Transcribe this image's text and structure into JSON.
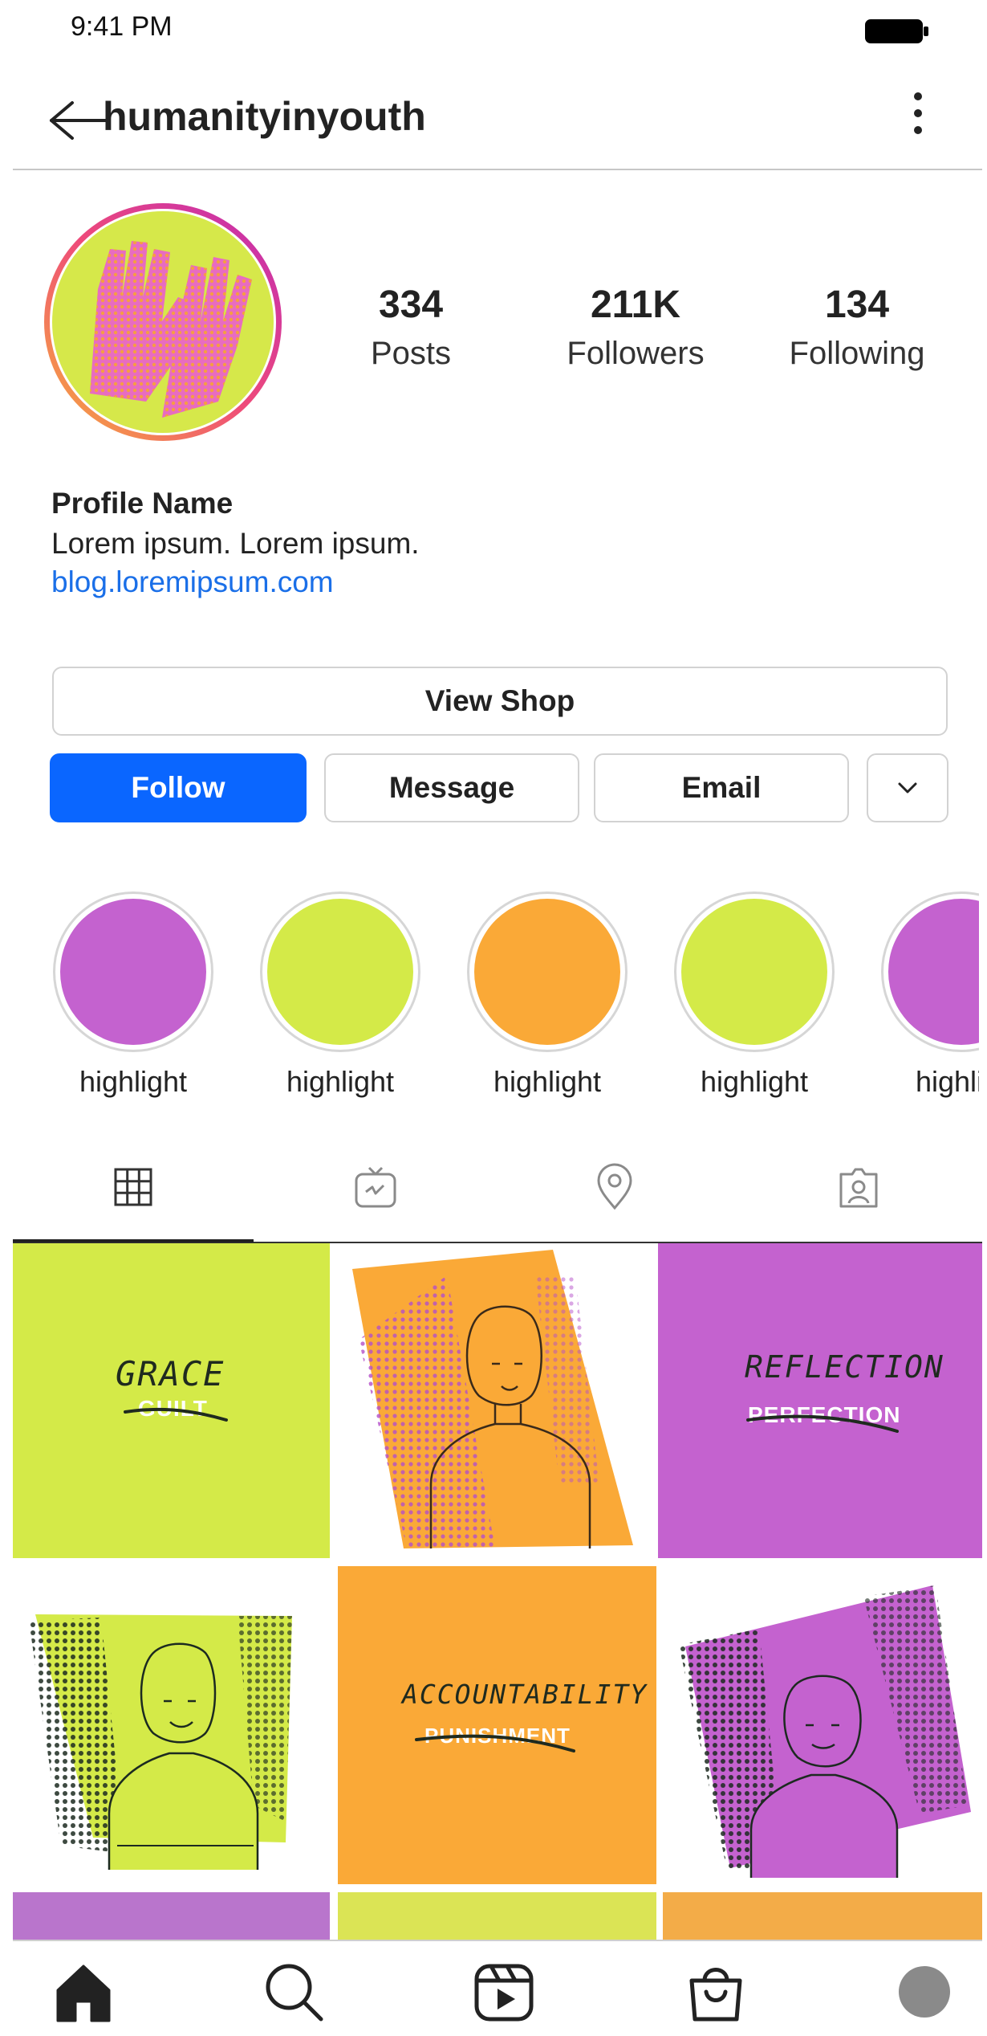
{
  "status_bar": {
    "time": "9:41 PM",
    "battery_icon": "battery-full-icon"
  },
  "header": {
    "username": "humanityinyouth",
    "back_icon": "arrow-left-icon",
    "more_icon": "more-vertical-icon"
  },
  "stats": [
    {
      "value": "334",
      "label": "Posts"
    },
    {
      "value": "211K",
      "label": "Followers"
    },
    {
      "value": "134",
      "label": "Following"
    }
  ],
  "bio": {
    "name": "Profile Name",
    "text": "Lorem ipsum. Lorem ipsum.",
    "link": "blog.loremipsum.com"
  },
  "buttons": {
    "view_shop": "View Shop",
    "follow": "Follow",
    "message": "Message",
    "email": "Email"
  },
  "highlights": [
    {
      "label": "highlight",
      "color": "#c462cf"
    },
    {
      "label": "highlight",
      "color": "#d4ea48"
    },
    {
      "label": "highlight",
      "color": "#faa937"
    },
    {
      "label": "highlight",
      "color": "#d4ea48"
    },
    {
      "label": "highlight",
      "color": "#c462cf"
    }
  ],
  "tabs": [
    {
      "icon": "grid-icon",
      "active": true
    },
    {
      "icon": "igtv-icon",
      "active": false
    },
    {
      "icon": "location-pin-icon",
      "active": false
    },
    {
      "icon": "tagged-user-icon",
      "active": false
    }
  ],
  "posts": [
    {
      "word": "GRACE",
      "struck": "GUILT",
      "bg": "#d4ea48"
    },
    {
      "bg": "#faa937"
    },
    {
      "word": "REFLECTION",
      "struck": "PERFECTION",
      "bg": "#c462cf"
    },
    {
      "bg": "#d4ea48"
    },
    {
      "word": "ACCOUNTABILITY",
      "struck": "PUNISHMENT",
      "bg": "#faa937"
    },
    {
      "bg": "#c462cf"
    }
  ],
  "colors": {
    "lime": "#d4ea48",
    "orange": "#faa937",
    "purple": "#c462cf",
    "follow_blue": "#0a66ff",
    "link_blue": "#1a6fe8"
  },
  "bottom_nav": [
    {
      "icon": "home-icon"
    },
    {
      "icon": "search-icon"
    },
    {
      "icon": "reels-icon"
    },
    {
      "icon": "shop-bag-icon"
    },
    {
      "icon": "profile-avatar-icon"
    }
  ]
}
